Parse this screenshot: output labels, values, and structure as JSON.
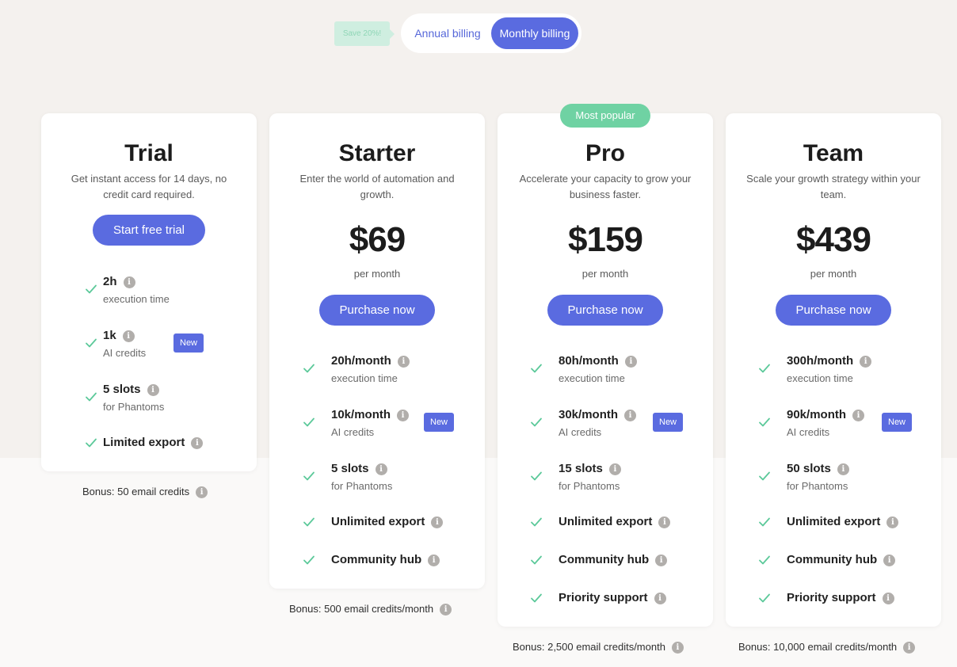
{
  "billing": {
    "save_tag": "Save 20%!",
    "annual_label": "Annual billing",
    "monthly_label": "Monthly billing",
    "selected": "Monthly billing"
  },
  "popular_badge": "Most popular",
  "info_glyph": "i",
  "colors": {
    "accent": "#5a6be0",
    "green": "#6fd2a3",
    "check": "#5cc99a",
    "background": "#f4f1ee"
  },
  "plans": [
    {
      "name": "Trial",
      "description": "Get instant access for 14 days, no credit card required.",
      "cta": "Start free trial",
      "features": [
        {
          "main": "2h",
          "sub": "execution time"
        },
        {
          "main": "1k",
          "sub": "AI credits",
          "badge": "New"
        },
        {
          "main": "5 slots",
          "sub": "for Phantoms"
        },
        {
          "main": "Limited export"
        }
      ],
      "bonus": "Bonus: 50 email credits"
    },
    {
      "name": "Starter",
      "description": "Enter the world of automation and growth.",
      "price": "$69",
      "period": "per month",
      "cta": "Purchase now",
      "features": [
        {
          "main": "20h/month",
          "sub": "execution time"
        },
        {
          "main": "10k/month",
          "sub": "AI credits",
          "badge": "New"
        },
        {
          "main": "5 slots",
          "sub": "for Phantoms"
        },
        {
          "main": "Unlimited export"
        },
        {
          "main": "Community hub"
        }
      ],
      "bonus": "Bonus: 500 email credits/month"
    },
    {
      "name": "Pro",
      "description": "Accelerate your capacity to grow your business faster.",
      "price": "$159",
      "period": "per month",
      "cta": "Purchase now",
      "features": [
        {
          "main": "80h/month",
          "sub": "execution time"
        },
        {
          "main": "30k/month",
          "sub": "AI credits",
          "badge": "New"
        },
        {
          "main": "15 slots",
          "sub": "for Phantoms"
        },
        {
          "main": "Unlimited export"
        },
        {
          "main": "Community hub"
        },
        {
          "main": "Priority support"
        }
      ],
      "bonus": "Bonus: 2,500 email credits/month"
    },
    {
      "name": "Team",
      "description": "Scale your growth strategy within your team.",
      "price": "$439",
      "period": "per month",
      "cta": "Purchase now",
      "features": [
        {
          "main": "300h/month",
          "sub": "execution time"
        },
        {
          "main": "90k/month",
          "sub": "AI credits",
          "badge": "New"
        },
        {
          "main": "50 slots",
          "sub": "for Phantoms"
        },
        {
          "main": "Unlimited export"
        },
        {
          "main": "Community hub"
        },
        {
          "main": "Priority support"
        }
      ],
      "bonus": "Bonus: 10,000 email credits/month"
    }
  ]
}
